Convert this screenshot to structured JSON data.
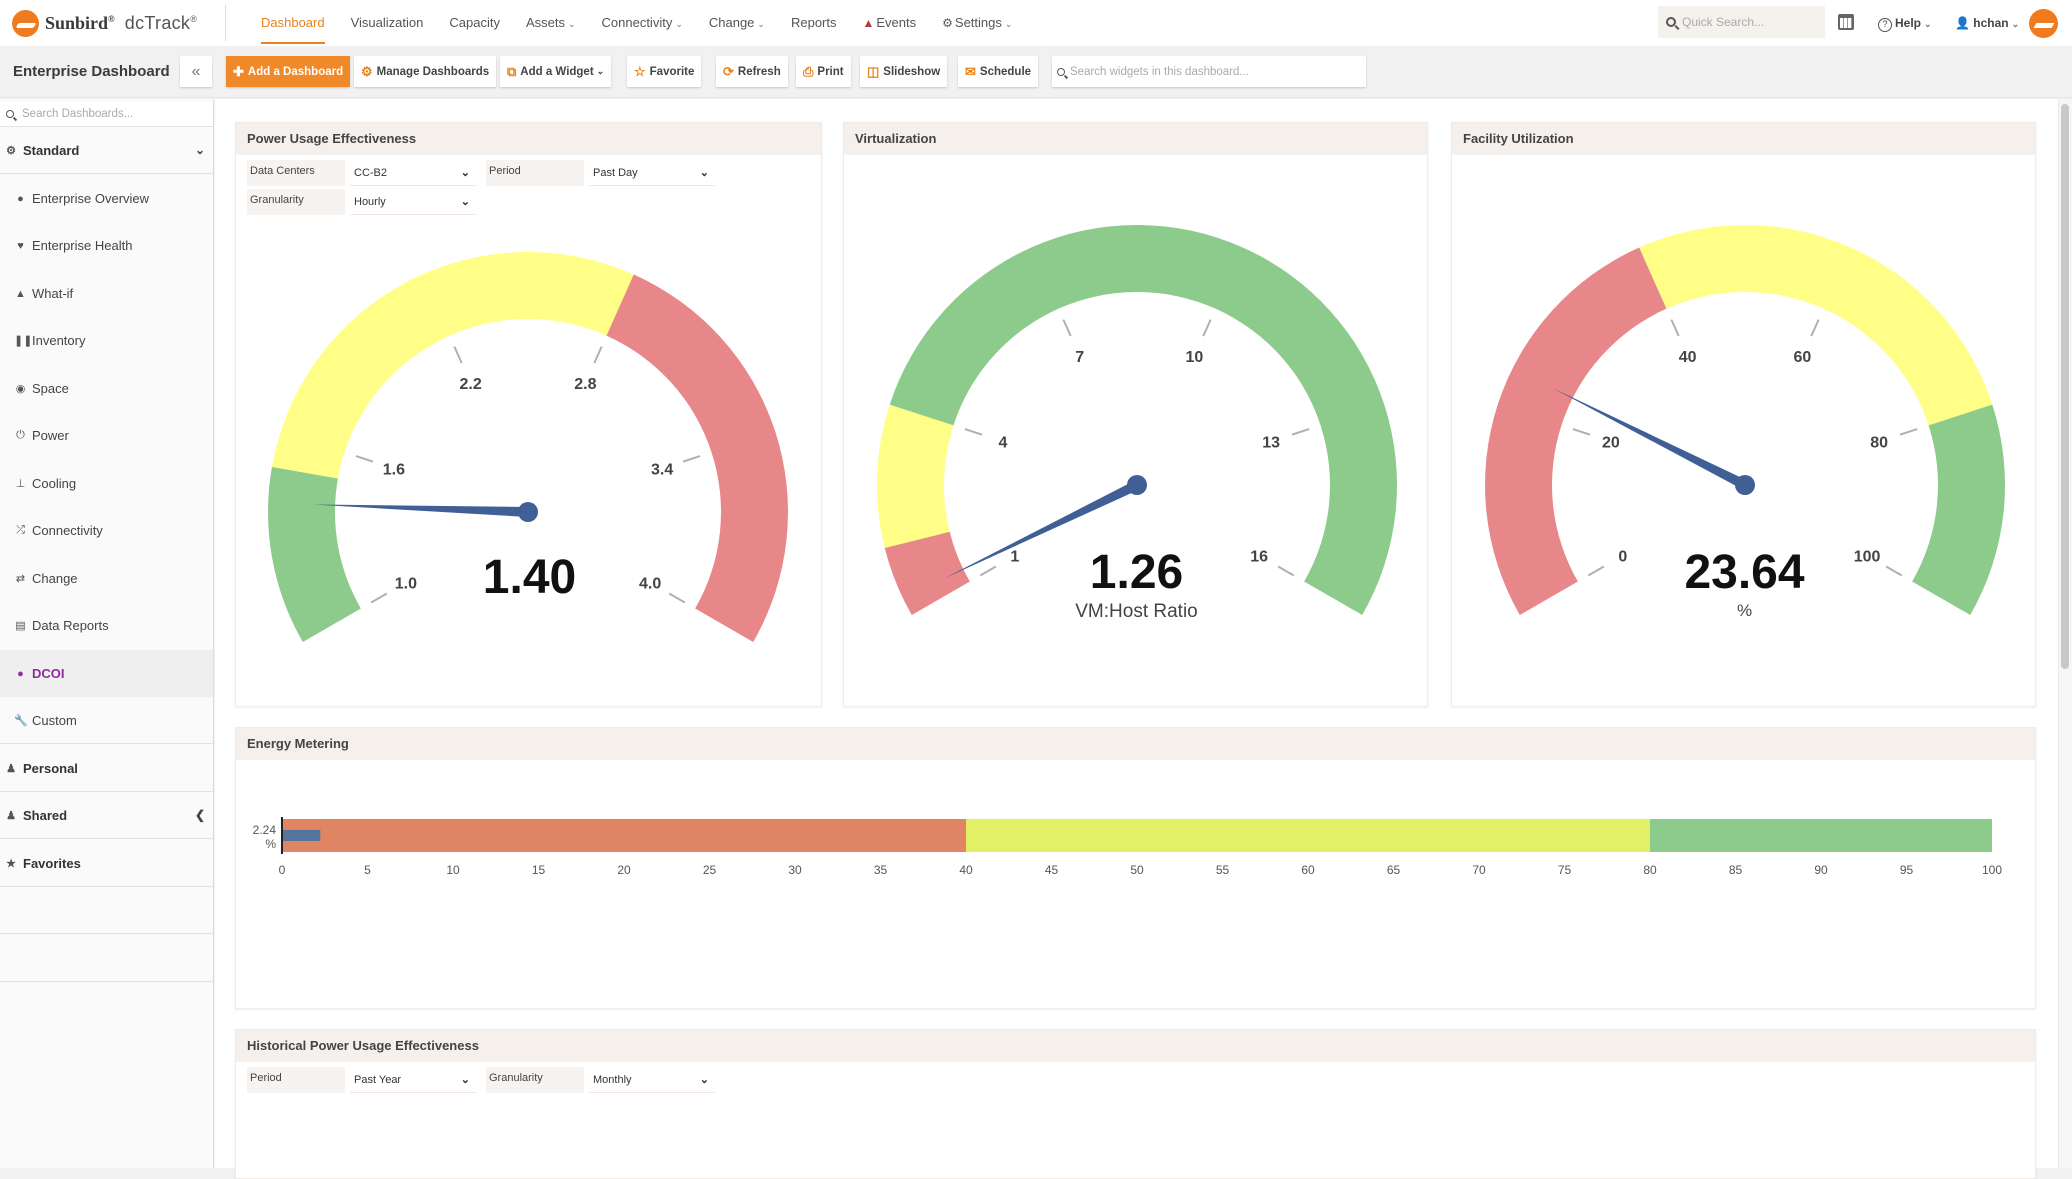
{
  "app": {
    "brand": "Sunbird",
    "product": "dcTrack",
    "reg": "®"
  },
  "nav": {
    "items": [
      {
        "label": "Dashboard",
        "active": true,
        "caret": false
      },
      {
        "label": "Visualization",
        "caret": false
      },
      {
        "label": "Capacity",
        "caret": false
      },
      {
        "label": "Assets",
        "caret": true
      },
      {
        "label": "Connectivity",
        "caret": true
      },
      {
        "label": "Change",
        "caret": true
      },
      {
        "label": "Reports",
        "caret": false
      },
      {
        "label": "Events",
        "caret": false,
        "icon": "bell-icon"
      },
      {
        "label": "Settings",
        "caret": true,
        "icon": "gear-icon"
      }
    ],
    "quick_search_placeholder": "Quick Search...",
    "help_label": "Help",
    "user_label": "hchan"
  },
  "toolbar": {
    "title": "Enterprise Dashboard",
    "collapse_label": "«",
    "buttons": {
      "add_dashboard": "Add a Dashboard",
      "manage_dashboards": "Manage Dashboards",
      "add_widget": "Add a Widget",
      "favorite": "Favorite",
      "refresh": "Refresh",
      "print": "Print",
      "slideshow": "Slideshow",
      "schedule": "Schedule"
    },
    "widget_search_placeholder": "Search widgets in this dashboard..."
  },
  "sidebar": {
    "search_placeholder": "Search Dashboards...",
    "groups": {
      "standard": "Standard",
      "personal": "Personal",
      "shared": "Shared",
      "favorites": "Favorites"
    },
    "items": [
      {
        "label": "Enterprise Overview",
        "icon": "globe-icon"
      },
      {
        "label": "Enterprise Health",
        "icon": "heartbeat-icon"
      },
      {
        "label": "What-if",
        "icon": "thumbs-up-icon"
      },
      {
        "label": "Inventory",
        "icon": "barcode-icon"
      },
      {
        "label": "Space",
        "icon": "dashboard-gauge-icon"
      },
      {
        "label": "Power",
        "icon": "power-icon"
      },
      {
        "label": "Cooling",
        "icon": "thermometer-icon"
      },
      {
        "label": "Connectivity",
        "icon": "random-icon"
      },
      {
        "label": "Change",
        "icon": "exchange-icon"
      },
      {
        "label": "Data Reports",
        "icon": "report-icon"
      },
      {
        "label": "DCOI",
        "icon": "dcoi-icon",
        "active": true
      },
      {
        "label": "Custom",
        "icon": "wrench-icon"
      }
    ]
  },
  "widgets": {
    "pue": {
      "title": "Power Usage Effectiveness",
      "filters": {
        "data_centers_label": "Data Centers",
        "data_centers_value": "CC-B2",
        "period_label": "Period",
        "period_value": "Past Day",
        "granularity_label": "Granularity",
        "granularity_value": "Hourly"
      },
      "value_text": "1.40",
      "unit": ""
    },
    "virtualization": {
      "title": "Virtualization",
      "value_text": "1.26",
      "unit": "VM:Host Ratio"
    },
    "facility": {
      "title": "Facility Utilization",
      "value_text": "23.64",
      "unit": "%"
    },
    "energy": {
      "title": "Energy Metering",
      "value_label": "2.24",
      "value_unit": "%"
    },
    "historical": {
      "title": "Historical Power Usage Effectiveness",
      "filters": {
        "period_label": "Period",
        "period_value": "Past Year",
        "granularity_label": "Granularity",
        "granularity_value": "Monthly"
      }
    }
  },
  "colors": {
    "accent": "#f0892a",
    "gauge_green": "#8ccb8b",
    "gauge_yellow": "#ffff88",
    "gauge_red": "#e8878a",
    "needle": "#3f5f95",
    "bullet_red": "#e08563",
    "bullet_yellow": "#e2f066",
    "bullet_green": "#8ccb8b",
    "bullet_bar": "#53759a",
    "active_item": "#8e2d9c"
  },
  "chart_data": [
    {
      "type": "gauge",
      "name": "pue",
      "title": "Power Usage Effectiveness",
      "min": 1.0,
      "max": 4.0,
      "ticks": [
        "1.0",
        "1.6",
        "2.2",
        "2.8",
        "3.4",
        "4.0"
      ],
      "tick_values": [
        1.0,
        1.6,
        2.2,
        2.8,
        3.4,
        4.0
      ],
      "bands": [
        {
          "from": 1.0,
          "to": 1.5,
          "color": "green"
        },
        {
          "from": 1.5,
          "to": 2.8,
          "color": "yellow"
        },
        {
          "from": 2.8,
          "to": 4.0,
          "color": "red"
        }
      ],
      "value": 1.4
    },
    {
      "type": "gauge",
      "name": "virtualization",
      "title": "Virtualization",
      "min": 1,
      "max": 16,
      "ticks": [
        "1",
        "4",
        "7",
        "10",
        "13",
        "16"
      ],
      "tick_values": [
        1,
        4,
        7,
        10,
        13,
        16
      ],
      "bands": [
        {
          "from": 1,
          "to": 2,
          "color": "red"
        },
        {
          "from": 2,
          "to": 4,
          "color": "yellow"
        },
        {
          "from": 4,
          "to": 16,
          "color": "green"
        }
      ],
      "value": 1.26,
      "unit": "VM:Host Ratio"
    },
    {
      "type": "gauge",
      "name": "facility",
      "title": "Facility Utilization",
      "min": 0,
      "max": 100,
      "ticks": [
        "0",
        "20",
        "40",
        "60",
        "80",
        "100"
      ],
      "tick_values": [
        0,
        20,
        40,
        60,
        80,
        100
      ],
      "bands": [
        {
          "from": 0,
          "to": 40,
          "color": "red"
        },
        {
          "from": 40,
          "to": 80,
          "color": "yellow"
        },
        {
          "from": 80,
          "to": 100,
          "color": "green"
        }
      ],
      "value": 23.64,
      "unit": "%"
    },
    {
      "type": "bullet",
      "name": "energy",
      "title": "Energy Metering",
      "min": 0,
      "max": 100,
      "ticks": [
        "0",
        "5",
        "10",
        "15",
        "20",
        "25",
        "30",
        "35",
        "40",
        "45",
        "50",
        "55",
        "60",
        "65",
        "70",
        "75",
        "80",
        "85",
        "90",
        "95",
        "100"
      ],
      "bands": [
        {
          "from": 0,
          "to": 40,
          "color": "red"
        },
        {
          "from": 40,
          "to": 80,
          "color": "yellow"
        },
        {
          "from": 80,
          "to": 100,
          "color": "green"
        }
      ],
      "value": 2.24,
      "value_label": "2.24 %"
    }
  ]
}
